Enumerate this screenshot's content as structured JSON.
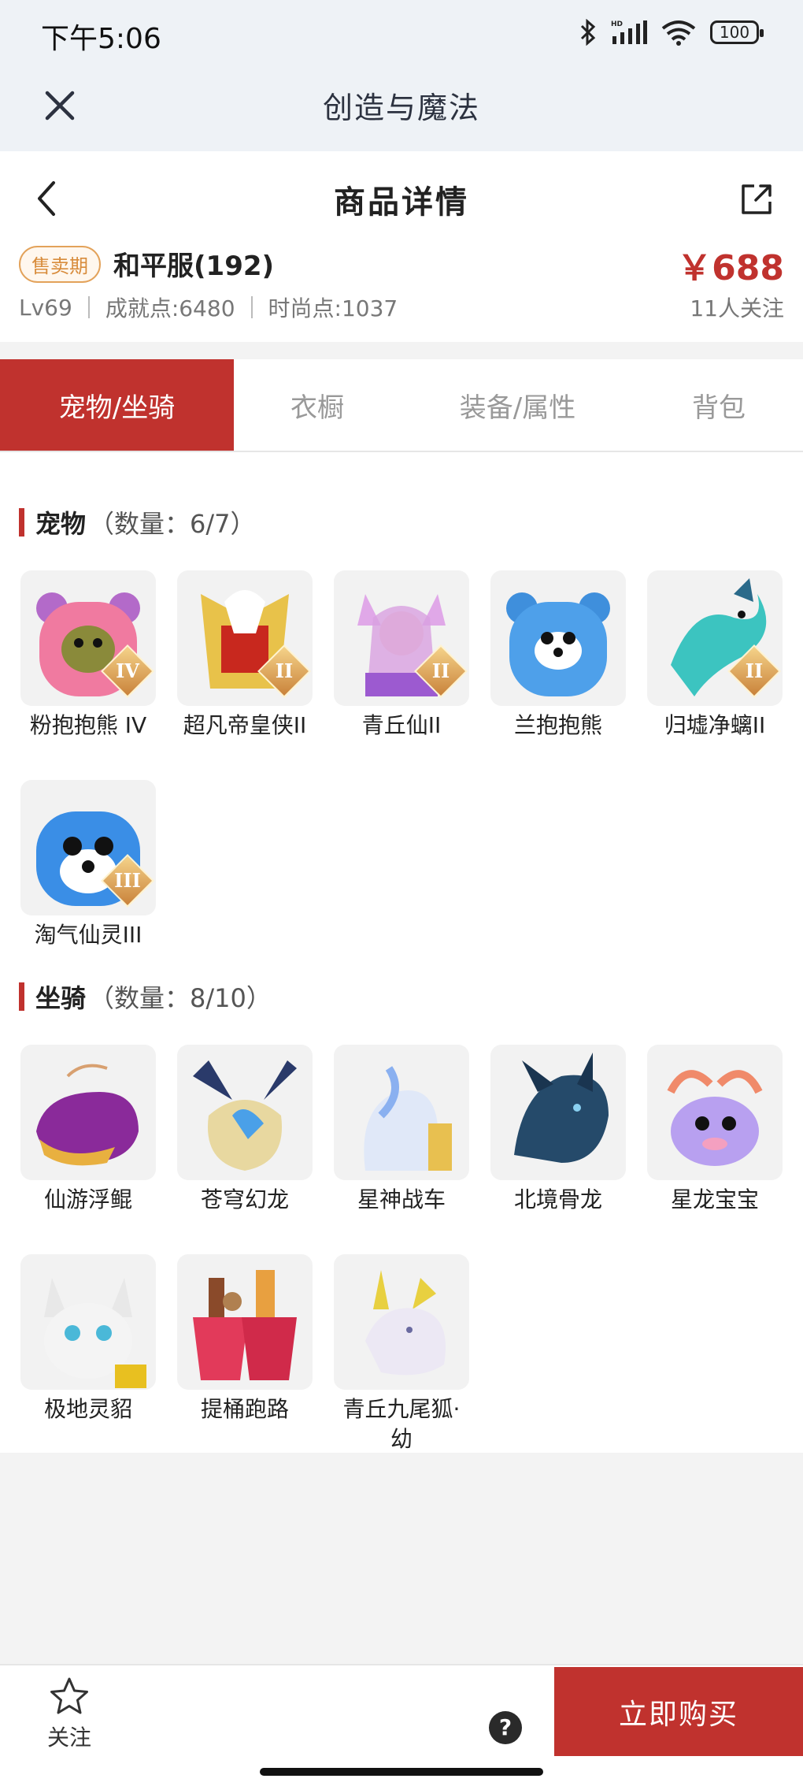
{
  "status_bar": {
    "time": "下午5:06",
    "battery": "100"
  },
  "app_bar": {
    "title": "创造与魔法"
  },
  "header": {
    "page_title": "商品详情",
    "sale_tag": "售卖期",
    "server_name": "和平服(192)",
    "level": "Lv69",
    "achievement": "成就点:6480",
    "fashion": "时尚点:1037",
    "price": "￥688",
    "followers": "11人关注"
  },
  "tabs": [
    {
      "label": "宠物/坐骑",
      "active": true
    },
    {
      "label": "衣橱",
      "active": false
    },
    {
      "label": "装备/属性",
      "active": false
    },
    {
      "label": "背包",
      "active": false
    }
  ],
  "pets": {
    "title": "宠物",
    "count": "（数量：6/7）",
    "items": [
      {
        "name": "粉抱抱熊 IV",
        "badge": "IV",
        "icon": "pink-bear-icon"
      },
      {
        "name": "超凡帝皇侠II",
        "badge": "II",
        "icon": "armored-hero-icon"
      },
      {
        "name": "青丘仙II",
        "badge": "II",
        "icon": "fox-fairy-icon"
      },
      {
        "name": "兰抱抱熊",
        "badge": "",
        "icon": "blue-bear-icon"
      },
      {
        "name": "归墟净螭II",
        "badge": "II",
        "icon": "water-dragon-icon"
      },
      {
        "name": "淘气仙灵III",
        "badge": "III",
        "icon": "blue-puppy-icon"
      }
    ]
  },
  "mounts": {
    "title": "坐骑",
    "count": "（数量：8/10）",
    "items": [
      {
        "name": "仙游浮鲲",
        "icon": "flying-whale-icon"
      },
      {
        "name": "苍穹幻龙",
        "icon": "sky-dragon-icon"
      },
      {
        "name": "星神战车",
        "icon": "star-chariot-icon"
      },
      {
        "name": "北境骨龙",
        "icon": "bone-dragon-icon"
      },
      {
        "name": "星龙宝宝",
        "icon": "baby-dragon-icon"
      },
      {
        "name": "极地灵貂",
        "icon": "polar-ferret-icon"
      },
      {
        "name": "提桶跑路",
        "icon": "bucket-icon"
      },
      {
        "name": "青丘九尾狐·幼",
        "icon": "nine-tail-fox-icon"
      }
    ]
  },
  "bottom_bar": {
    "follow_label": "关注",
    "help_label": "?",
    "buy_label": "立即购买"
  },
  "colors": {
    "accent": "#c0322e",
    "tag": "#d88c3c",
    "muted": "#999999"
  }
}
